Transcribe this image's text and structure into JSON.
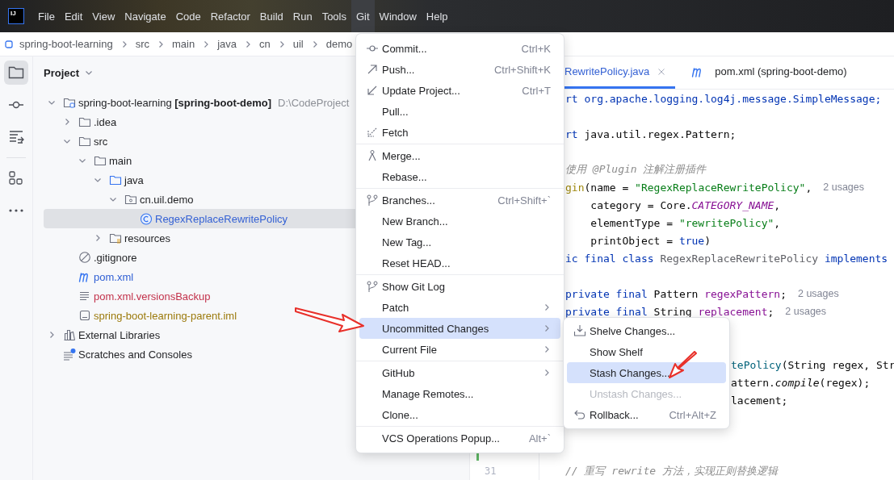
{
  "logo": "IJ",
  "menu_bar": [
    {
      "label": "File",
      "selected": false
    },
    {
      "label": "Edit",
      "selected": false
    },
    {
      "label": "View",
      "selected": false
    },
    {
      "label": "Navigate",
      "selected": false
    },
    {
      "label": "Code",
      "selected": false
    },
    {
      "label": "Refactor",
      "selected": false
    },
    {
      "label": "Build",
      "selected": false
    },
    {
      "label": "Run",
      "selected": false
    },
    {
      "label": "Tools",
      "selected": false
    },
    {
      "label": "Git",
      "selected": true
    },
    {
      "label": "Window",
      "selected": false
    },
    {
      "label": "Help",
      "selected": false
    }
  ],
  "breadcrumbs": [
    "spring-boot-learning",
    "src",
    "main",
    "java",
    "cn",
    "uil",
    "demo"
  ],
  "tool_strip": [
    {
      "kind": "project",
      "selected": true
    },
    {
      "kind": "commit",
      "selected": false
    },
    {
      "kind": "structure",
      "selected": false
    },
    {
      "kind": "components",
      "selected": false
    },
    {
      "kind": "more",
      "selected": false
    }
  ],
  "project_panel": {
    "title": "Project",
    "tree": [
      {
        "label": "spring-boot-learning **[spring-boot-demo]**",
        "path": "D:\\CodeProject",
        "kind": "module",
        "expanded": true,
        "selected": false,
        "children": [
          {
            "label": ".idea",
            "kind": "folder",
            "expanded": false,
            "selected": false
          },
          {
            "label": "src",
            "kind": "folder",
            "expanded": true,
            "selected": false,
            "children": [
              {
                "label": "main",
                "kind": "folder",
                "expanded": true,
                "selected": false,
                "children": [
                  {
                    "label": "java",
                    "kind": "source-folder",
                    "expanded": true,
                    "selected": false,
                    "children": [
                      {
                        "label": "cn.uil.demo",
                        "kind": "package",
                        "expanded": true,
                        "selected": false,
                        "children": [
                          {
                            "label": "RegexReplaceRewritePolicy",
                            "kind": "class",
                            "color": "#3461d4",
                            "selected": true
                          }
                        ]
                      }
                    ]
                  },
                  {
                    "label": "resources",
                    "kind": "resource-folder",
                    "expanded": false,
                    "selected": false
                  }
                ]
              }
            ]
          },
          {
            "label": ".gitignore",
            "kind": "ignore",
            "selected": false
          },
          {
            "label": "pom.xml",
            "kind": "maven",
            "color": "#2f5fd4",
            "selected": false
          },
          {
            "label": "pom.xml.versionsBackup",
            "kind": "text",
            "color": "#c3324b",
            "selected": false
          },
          {
            "label": "spring-boot-learning-parent.iml",
            "kind": "iml",
            "color": "#9c7a0c",
            "selected": false
          }
        ]
      },
      {
        "label": "External Libraries",
        "kind": "library",
        "expanded": false,
        "selected": false
      },
      {
        "label": "Scratches and Consoles",
        "kind": "scratches",
        "selected": false
      }
    ]
  },
  "editor_tabs": [
    {
      "label": "RewritePolicy.java",
      "selected": true,
      "closable": true
    },
    {
      "label": "pom.xml (spring-boot-demo)",
      "kind": "maven",
      "selected": false,
      "closable": false
    }
  ],
  "gutter": [
    {
      "changed": true
    },
    {
      "number": "31",
      "changed": false
    }
  ],
  "code_lines": [
    {
      "segments": [
        {
          "kind": "keyword",
          "text": "rt org.apache.logging.log4j.message.SimpleMessage;"
        }
      ]
    },
    {
      "blank": true
    },
    {
      "segments": [
        {
          "kind": "keyword",
          "text": "rt "
        },
        {
          "kind": "plain",
          "text": "java.util.regex.Pattern;"
        }
      ]
    },
    {
      "blank": true
    },
    {
      "segments": [
        {
          "kind": "comment",
          "text": "使用 @Plugin 注解注册插件"
        }
      ]
    },
    {
      "segments": [
        {
          "kind": "annotation",
          "text": "gin"
        },
        {
          "kind": "plain",
          "text": "(name = "
        },
        {
          "kind": "string",
          "text": "\"RegexReplaceRewritePolicy\""
        },
        {
          "kind": "plain",
          "text": ","
        }
      ],
      "hint": "2 usages"
    },
    {
      "segments": [
        {
          "kind": "plain",
          "text": "    category = Core."
        },
        {
          "kind": "constant",
          "text": "CATEGORY_NAME"
        },
        {
          "kind": "plain",
          "text": ","
        }
      ]
    },
    {
      "segments": [
        {
          "kind": "plain",
          "text": "    elementType = "
        },
        {
          "kind": "string",
          "text": "\"rewritePolicy\""
        },
        {
          "kind": "plain",
          "text": ","
        }
      ]
    },
    {
      "segments": [
        {
          "kind": "plain",
          "text": "    printObject = "
        },
        {
          "kind": "keyword",
          "text": "true"
        },
        {
          "kind": "plain",
          "text": ")"
        }
      ]
    },
    {
      "segments": [
        {
          "kind": "keyword",
          "text": "ic final class "
        },
        {
          "kind": "muted",
          "text": "RegexReplaceRewritePolicy "
        },
        {
          "kind": "keyword",
          "text": "implements"
        }
      ]
    },
    {
      "blank": true
    },
    {
      "segments": [
        {
          "kind": "keyword",
          "text": "private final "
        },
        {
          "kind": "plain",
          "text": "Pattern "
        },
        {
          "kind": "field",
          "text": "regexPattern"
        },
        {
          "kind": "plain",
          "text": ";"
        }
      ],
      "hint": "2 usages"
    },
    {
      "segments": [
        {
          "kind": "keyword",
          "text": "private final "
        },
        {
          "kind": "plain",
          "text": "String "
        },
        {
          "kind": "field",
          "text": "replacement"
        },
        {
          "kind": "plain",
          "text": ";"
        }
      ],
      "hint": "2 usages"
    },
    {
      "blank": true
    },
    {
      "blank": true
    },
    {
      "under_popup": true,
      "segments": [
        {
          "kind": "method",
          "text": "tePolicy"
        },
        {
          "kind": "plain",
          "text": "(String regex, Str"
        }
      ]
    },
    {
      "under_popup": true,
      "segments": [
        {
          "kind": "plain",
          "text": "attern."
        },
        {
          "kind": "italic",
          "text": "compile"
        },
        {
          "kind": "plain",
          "text": "(regex);"
        }
      ]
    },
    {
      "under_popup": true,
      "segments": [
        {
          "kind": "plain",
          "text": "lacement;"
        }
      ]
    },
    {
      "blank": true
    },
    {
      "blank": true
    },
    {
      "blank": true
    },
    {
      "segments": [
        {
          "kind": "comment",
          "text": "// 重写 rewrite 方法，实现正则替换逻辑"
        }
      ]
    }
  ],
  "git_menu": {
    "groups": [
      [
        {
          "label": "Commit...",
          "kind": "commit",
          "shortcut": "Ctrl+K",
          "submenu": false,
          "selected": false
        },
        {
          "label": "Push...",
          "kind": "push",
          "shortcut": "Ctrl+Shift+K",
          "submenu": false,
          "selected": false
        },
        {
          "label": "Update Project...",
          "kind": "update",
          "shortcut": "Ctrl+T",
          "submenu": false,
          "selected": false
        },
        {
          "label": "Pull...",
          "submenu": false,
          "selected": false
        },
        {
          "label": "Fetch",
          "kind": "fetch",
          "submenu": false,
          "selected": false
        }
      ],
      [
        {
          "label": "Merge...",
          "kind": "merge",
          "submenu": false,
          "selected": false
        },
        {
          "label": "Rebase...",
          "submenu": false,
          "selected": false
        }
      ],
      [
        {
          "label": "Branches...",
          "kind": "branch",
          "shortcut": "Ctrl+Shift+`",
          "submenu": false,
          "selected": false
        },
        {
          "label": "New Branch...",
          "submenu": false,
          "selected": false
        },
        {
          "label": "New Tag...",
          "submenu": false,
          "selected": false
        },
        {
          "label": "Reset HEAD...",
          "submenu": false,
          "selected": false
        }
      ],
      [
        {
          "label": "Show Git Log",
          "kind": "branch",
          "submenu": false,
          "selected": false
        },
        {
          "label": "Patch",
          "submenu": true,
          "selected": false
        },
        {
          "label": "Uncommitted Changes",
          "submenu": true,
          "selected": true
        },
        {
          "label": "Current File",
          "submenu": true,
          "selected": false
        }
      ],
      [
        {
          "label": "GitHub",
          "submenu": true,
          "selected": false
        },
        {
          "label": "Manage Remotes...",
          "submenu": false,
          "selected": false
        },
        {
          "label": "Clone...",
          "submenu": false,
          "selected": false
        }
      ],
      [
        {
          "label": "VCS Operations Popup...",
          "shortcut": "Alt+`",
          "submenu": false,
          "selected": false
        }
      ]
    ]
  },
  "changes_submenu": [
    {
      "label": "Shelve Changes...",
      "kind": "shelve",
      "selected": false,
      "disabled": false
    },
    {
      "label": "Show Shelf",
      "selected": false,
      "disabled": false
    },
    {
      "label": "Stash Changes...",
      "selected": true,
      "disabled": false
    },
    {
      "label": "Unstash Changes...",
      "selected": false,
      "disabled": true
    },
    {
      "label": "Rollback...",
      "kind": "rollback",
      "shortcut": "Ctrl+Alt+Z",
      "selected": false,
      "disabled": false
    }
  ]
}
